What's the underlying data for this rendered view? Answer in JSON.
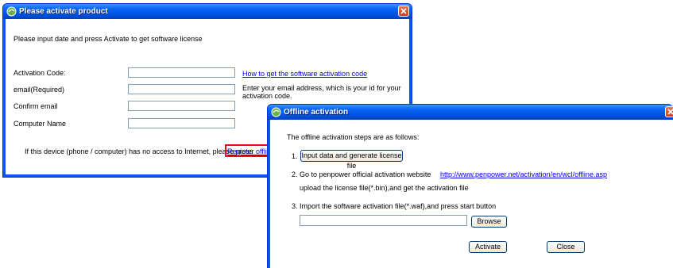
{
  "activate_window": {
    "title": "Please activate product",
    "instruction": "Please input date and press Activate to get software license",
    "activation_code_label": "Activation Code:",
    "how_to_link": "How to get the software activation code",
    "email_label": "email(Required)",
    "email_help_line1": "Enter your email address, which is your id for your",
    "email_help_line2": "activation code.",
    "confirm_email_label": "Confirm email",
    "computer_name_label": "Computer Name",
    "offline_note": "If this device (phone / computer) has no access to Internet, please press",
    "register_offline_link": "Register offline",
    "activation_code_value": "",
    "email_value": "",
    "confirm_email_value": "",
    "computer_name_value": ""
  },
  "offline_window": {
    "title": "Offline activation",
    "intro": "The offline activation steps are as follows:",
    "step1_number": "1.",
    "step1_button": "Input data and generate license file",
    "step2_text": "2.  Go to penpower official activation website",
    "step2_url": "http://www.penpower.net/activation/en/wcl/offline.asp",
    "step2_line2": "upload the license file(*.bin),and get the activation file",
    "step3_text": "3.  Import the software activation file(*.waf),and press start button",
    "file_path_value": "",
    "browse_button": "Browse",
    "activate_button": "Activate",
    "close_button": "Close"
  },
  "colors": {
    "titlebar": "#0054e3",
    "link": "#0000ee",
    "highlight": "#e0101a",
    "close": "#d0502b"
  },
  "icons": [
    "app-icon",
    "close-icon"
  ]
}
